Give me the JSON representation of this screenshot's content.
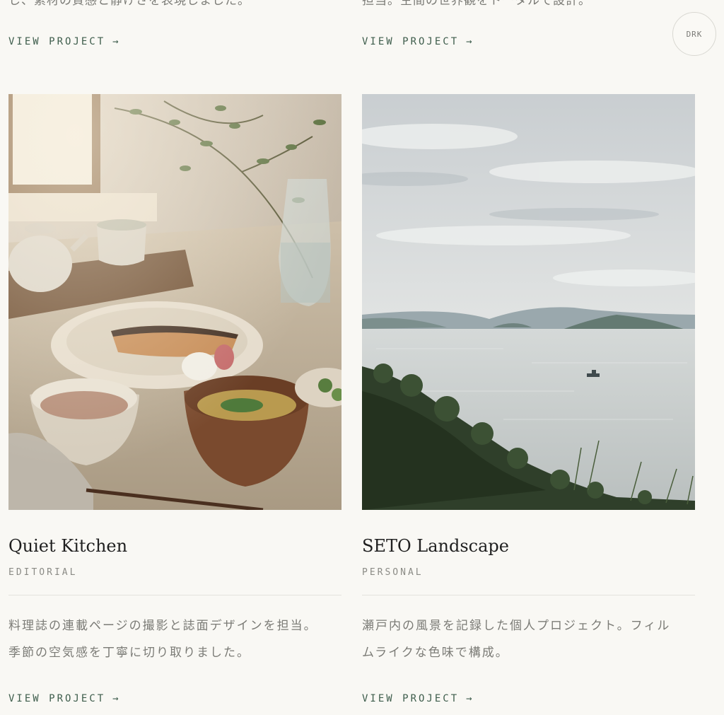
{
  "top_row": {
    "left_desc_tail": "し、素材の質感と静けさを表現しました。",
    "right_desc_tail": "担当。空間の世界観をトータルで設計。",
    "link_label": "VIEW PROJECT",
    "link_arrow": "→"
  },
  "theme_toggle": {
    "label": "DRK"
  },
  "projects": [
    {
      "title": "Quiet Kitchen",
      "category": "EDITORIAL",
      "description_line1": "料理誌の連載ページの撮影と誌面デザインを担当。",
      "description_line2": "季節の空気感を丁寧に切り取りました。",
      "link_label": "VIEW PROJECT",
      "link_arrow": "→",
      "image_icon": "food-photo"
    },
    {
      "title": "SETO Landscape",
      "category": "PERSONAL",
      "description_line1": "瀬戸内の風景を記録した個人プロジェクト。フィル",
      "description_line2": "ムライクな色味で構成。",
      "link_label": "VIEW PROJECT",
      "link_arrow": "→",
      "image_icon": "seascape-photo"
    }
  ]
}
